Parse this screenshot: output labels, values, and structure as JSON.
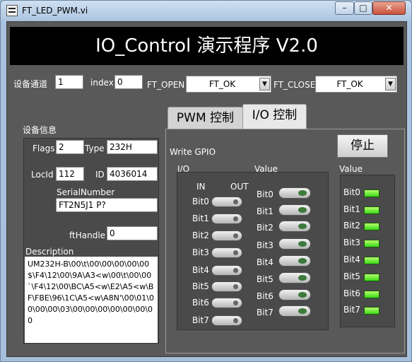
{
  "window": {
    "title": "FT_LED_PWM.vi",
    "controls": {
      "minimize": "–",
      "maximize": "□",
      "close": "✕"
    }
  },
  "header": {
    "title": "IO_Control 演示程序 V2.0"
  },
  "top": {
    "channel_label": "设备通道",
    "channel_value": "1",
    "index_label": "index",
    "index_value": "0",
    "ft_open_label": "FT_OPEN",
    "ft_open_value": "FT_OK",
    "ft_close_label": "FT_CLOSE",
    "ft_close_value": "FT_OK"
  },
  "device_info": {
    "section_label": "设备信息",
    "flags_label": "Flags",
    "flags_value": "2",
    "type_label": "Type",
    "type_value": "232H",
    "locid_label": "LocId",
    "locid_value": "112",
    "id_label": "ID",
    "id_value": "4036014",
    "serial_label": "SerialNumber",
    "serial_value": "FT2N5J1      P?",
    "fthandle_label": "ftHandle",
    "fthandle_value": "0",
    "description_label": "Description",
    "description_value": "UM232H-B\\00\\t\\00\\00\\00\\00\\00$\\F4\\12\\00\\9A\\A3<w\\00\\t\\00\\00`\\F4\\12\\00\\BC\\A5<w\\E2\\A5<w\\BF\\FBE\\96\\1C\\A5<w\\A8N'\\00\\01\\00\\00\\00\\03\\00\\00\\00\\00\\00\\00\\00"
  },
  "tabs": [
    {
      "label": "PWM 控制",
      "active": false
    },
    {
      "label": "I/O 控制",
      "active": true
    }
  ],
  "io_tab": {
    "write_gpio_label": "Write GPIO",
    "stop_button": "停止",
    "io_label": "I/O",
    "value_label": "Value",
    "in_label": "IN",
    "out_label": "OUT",
    "read_value_label": "Value",
    "io_bits": [
      "Bit0",
      "Bit1",
      "Bit2",
      "Bit3",
      "Bit4",
      "Bit5",
      "Bit6",
      "Bit7"
    ],
    "value_bits": [
      "Bit0",
      "Bit1",
      "Bit2",
      "Bit3",
      "Bit4",
      "Bit5",
      "Bit6",
      "Bit7"
    ],
    "led_bits": [
      "Bit0",
      "Bit1",
      "Bit2",
      "Bit3",
      "Bit4",
      "Bit5",
      "Bit6",
      "Bit7"
    ],
    "led_color": "#38d817"
  }
}
